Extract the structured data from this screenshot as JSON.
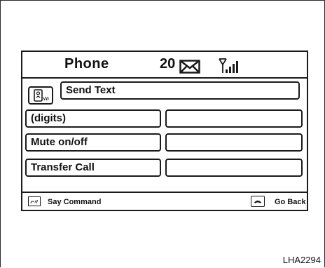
{
  "header": {
    "title": "Phone",
    "message_count": "20",
    "mail_icon": "envelope-icon",
    "signal_icon": "signal-strength-icon"
  },
  "voice_button": {
    "icon": "voice-command-icon"
  },
  "send_text": {
    "label": "Send Text"
  },
  "menu": {
    "items": [
      {
        "label": "(digits)"
      },
      {
        "label": "Mute on/off"
      },
      {
        "label": "Transfer Call"
      }
    ]
  },
  "footer": {
    "say_command_label": "Say Command",
    "say_command_icon": "voice-command-icon",
    "go_back_label": "Go Back",
    "go_back_icon": "hang-up-icon"
  },
  "caption": "LHA2294",
  "colors": {
    "border": "#1a1a1a",
    "background": "#ffffff",
    "text": "#111111"
  }
}
